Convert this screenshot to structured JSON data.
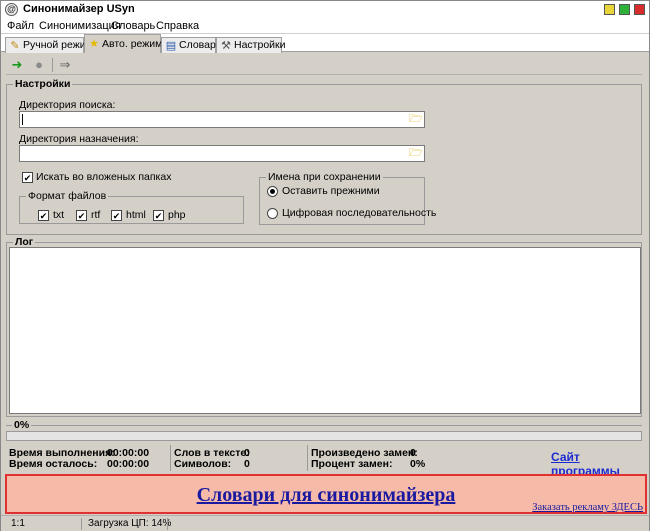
{
  "window": {
    "title": "Синонимайзер USyn",
    "controls": [
      "minimize",
      "maximize",
      "close"
    ]
  },
  "menu": [
    "Файл",
    "Синонимизация",
    "Словарь",
    "Справка"
  ],
  "tabs": [
    {
      "label": "Ручной режим",
      "icon": "pencil-icon",
      "active": false
    },
    {
      "label": "Авто. режим",
      "icon": "star-icon",
      "active": true
    },
    {
      "label": "Словари",
      "icon": "book-icon",
      "active": false
    },
    {
      "label": "Настройки",
      "icon": "wrench-icon",
      "active": false
    }
  ],
  "toolbar": {
    "icons": [
      "run-arrow-icon",
      "stop-icon",
      "next-arrow-icon"
    ]
  },
  "settings": {
    "title": "Настройки",
    "search_dir_label": "Директория поиска:",
    "search_dir_value": "",
    "dest_dir_label": "Директория назначения:",
    "dest_dir_value": "",
    "subfolders_label": "Искать во вложеных папках",
    "subfolders_checked": true,
    "formats_title": "Формат файлов",
    "formats": [
      {
        "label": "txt",
        "checked": true
      },
      {
        "label": "rtf",
        "checked": true
      },
      {
        "label": "html",
        "checked": true
      },
      {
        "label": "php",
        "checked": true
      }
    ],
    "naming_title": "Имена при сохранении",
    "naming_options": [
      {
        "label": "Оставить прежними",
        "selected": true
      },
      {
        "label": "Цифровая последовательность",
        "selected": false
      }
    ]
  },
  "log": {
    "title": "Лог",
    "content": ""
  },
  "progress": {
    "label": "0%",
    "value": 0
  },
  "stats": {
    "run_time_label": "Время выполнения:",
    "run_time_value": "00:00:00",
    "remaining_label": "Время осталось:",
    "remaining_value": "00:00:00",
    "words_label": "Слов в тексте:",
    "words_value": "0",
    "chars_label": "Символов:",
    "chars_value": "0",
    "replacements_label": "Произведено замен:",
    "replacements_value": "0",
    "percent_label": "Процент замен:",
    "percent_value": "0%",
    "site_link": "Сайт программы"
  },
  "banner": {
    "title": "Словари для синонимайзера",
    "ad_link": "Заказать рекламу ЗДЕСЬ",
    "background": "#f6bba8",
    "border": "#e03030"
  },
  "statusbar": {
    "position": "1:1",
    "cpu": "Загрузка ЦП: 14%"
  }
}
